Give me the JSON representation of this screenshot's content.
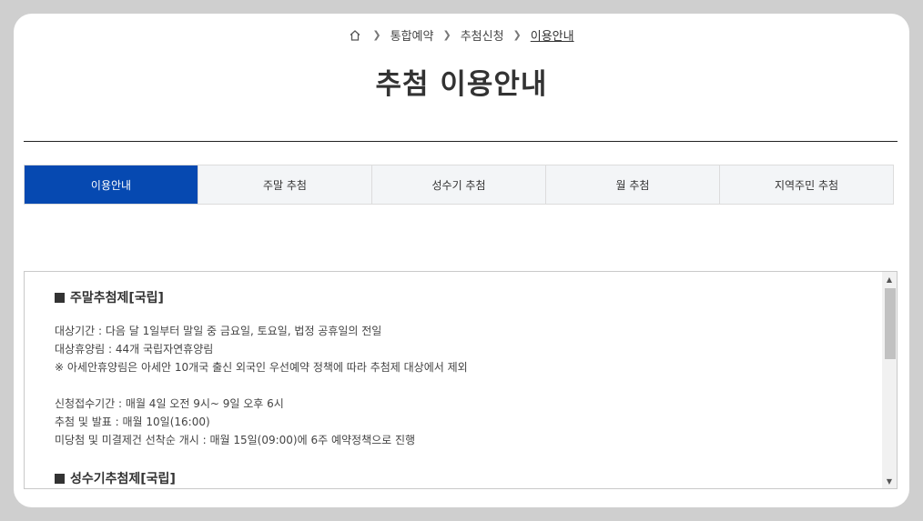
{
  "breadcrumb": {
    "items": [
      "통합예약",
      "추첨신청",
      "이용안내"
    ]
  },
  "page": {
    "title": "추첨 이용안내"
  },
  "tabs": [
    {
      "label": "이용안내",
      "active": true
    },
    {
      "label": "주말 추첨",
      "active": false
    },
    {
      "label": "성수기 추첨",
      "active": false
    },
    {
      "label": "월 추첨",
      "active": false
    },
    {
      "label": "지역주민 추첨",
      "active": false
    }
  ],
  "content": {
    "section1": {
      "title": "주말추첨제[국립]",
      "lines": [
        "대상기간 : 다음 달 1일부터 말일 중 금요일, 토요일, 법정 공휴일의 전일",
        "대상휴양림 : 44개 국립자연휴양림",
        "※ 아세안휴양림은 아세안 10개국 출신 외국인 우선예약 정책에 따라 추첨제 대상에서 제외"
      ],
      "lines2": [
        "신청접수기간 : 매월 4일 오전 9시~ 9일 오후 6시",
        "추첨 및 발표 : 매월 10일(16:00)",
        "미당첨 및 미결제건 선착순 개시 : 매월 15일(09:00)에 6주 예약정책으로 진행"
      ]
    },
    "section2": {
      "title": "성수기추첨제[국립]"
    }
  },
  "colors": {
    "active_tab": "#0649b1",
    "tab_bg": "#f3f5f7"
  },
  "icons": {
    "home": "home-icon",
    "chevron": "chevron-right-icon"
  }
}
